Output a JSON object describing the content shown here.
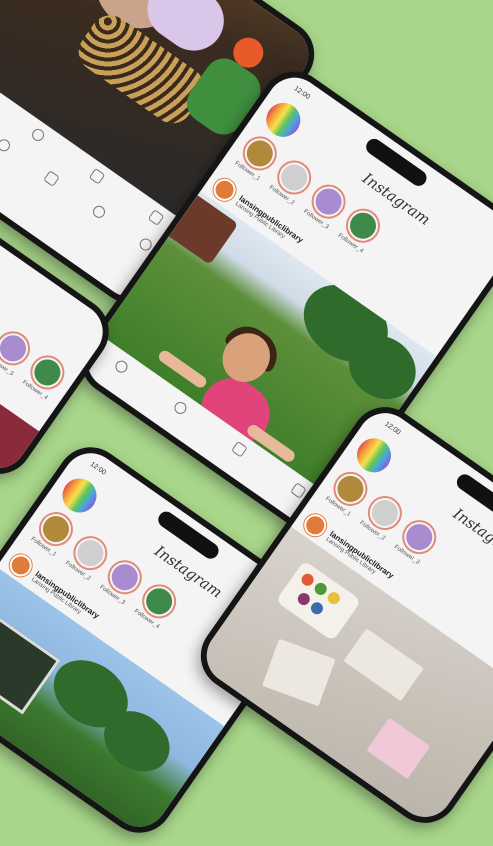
{
  "app_title": "Instagram",
  "status_time": "12:00",
  "account": {
    "name": "lansingpubliclibrary",
    "subtitle": "Lansing Public Library"
  },
  "stories": [
    {
      "label": "Follower_1",
      "color": "#b08a3a"
    },
    {
      "label": "Follower_2",
      "color": "#cfcfcf"
    },
    {
      "label": "Follower_3",
      "color": "#a98bd0"
    },
    {
      "label": "Follower_4",
      "color": "#3f8a4a"
    }
  ],
  "colors": {
    "background": "#a8d68a",
    "phone_frame": "#151515",
    "story_ring": "#e28a7a",
    "account_avatar": "#e07b3a"
  },
  "icons": [
    "home-icon",
    "search-icon",
    "add-post-icon",
    "heart-icon",
    "profile-icon",
    "like-icon",
    "comment-icon",
    "share-icon",
    "bookmark-icon"
  ]
}
